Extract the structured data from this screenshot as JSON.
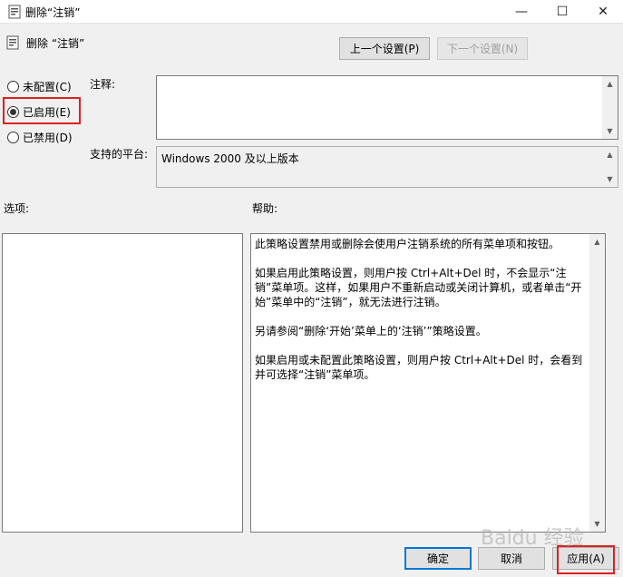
{
  "window": {
    "title": "删除“注销”",
    "minimize_glyph": "—",
    "maximize_glyph": "☐",
    "close_glyph": "✕"
  },
  "header": {
    "title": "删除 “注销”",
    "prev_setting_label": "上一个设置(P)",
    "next_setting_label": "下一个设置(N)"
  },
  "state_options": [
    {
      "label": "未配置(C)",
      "checked": false
    },
    {
      "label": "已启用(E)",
      "checked": true
    },
    {
      "label": "已禁用(D)",
      "checked": false
    }
  ],
  "comment": {
    "label": "注释:",
    "value": ""
  },
  "platform": {
    "label": "支持的平台:",
    "value": "Windows 2000 及以上版本"
  },
  "options": {
    "label": "选项:"
  },
  "help": {
    "label": "帮助:",
    "paragraphs": [
      "此策略设置禁用或删除会使用户注销系统的所有菜单项和按钮。",
      "如果启用此策略设置，则用户按 Ctrl+Alt+Del 时，不会显示“注销”菜单项。这样，如果用户不重新启动或关闭计算机，或者单击“开始”菜单中的“注销”，就无法进行注销。",
      "另请参阅“删除‘开始’菜单上的‘注销’”策略设置。",
      "如果启用或未配置此策略设置，则用户按 Ctrl+Alt+Del 时，会看到并可选择“注销”菜单项。"
    ]
  },
  "footer": {
    "ok_label": "确定",
    "cancel_label": "取消",
    "apply_label": "应用(A)"
  },
  "watermark": "Baidu 经验",
  "colors": {
    "highlight": "#e02020",
    "focus": "#0078d7"
  }
}
